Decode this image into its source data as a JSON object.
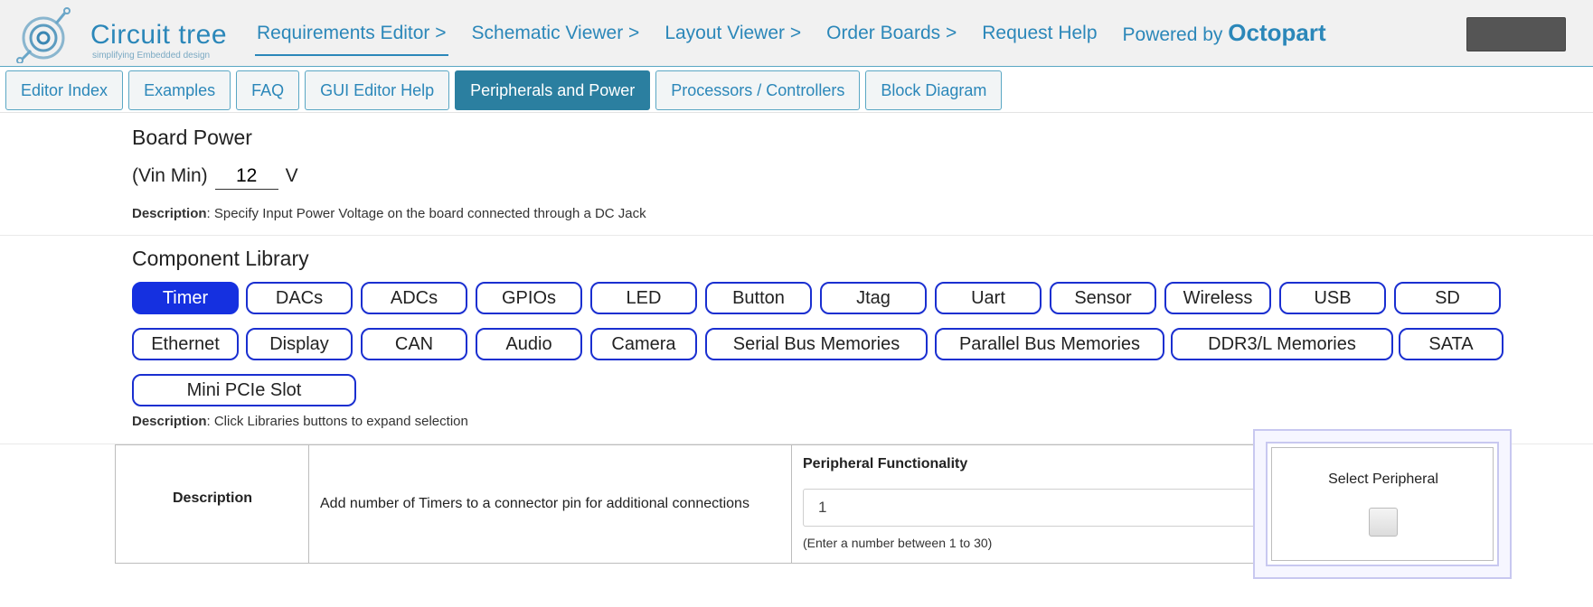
{
  "header": {
    "logo_text": "Circuit tree",
    "logo_sub": "simplifying Embedded design",
    "nav": [
      {
        "label": "Requirements Editor >"
      },
      {
        "label": "Schematic Viewer >"
      },
      {
        "label": "Layout Viewer >"
      },
      {
        "label": "Order Boards >"
      },
      {
        "label": "Request Help"
      }
    ],
    "powered_by": "Powered by",
    "octopart": "Octopart"
  },
  "tabs": [
    {
      "label": "Editor Index"
    },
    {
      "label": "Examples"
    },
    {
      "label": "FAQ"
    },
    {
      "label": "GUI Editor Help"
    },
    {
      "label": "Peripherals and Power"
    },
    {
      "label": "Processors / Controllers"
    },
    {
      "label": "Block Diagram"
    }
  ],
  "board_power": {
    "title": "Board Power",
    "vin_label": "(Vin Min)",
    "vin_value": "12",
    "unit": "V",
    "desc_label": "Description",
    "desc_text": ": Specify Input Power Voltage on the board connected through a DC Jack"
  },
  "library": {
    "title": "Component Library",
    "buttons": [
      "Timer",
      "DACs",
      "ADCs",
      "GPIOs",
      "LED",
      "Button",
      "Jtag",
      "Uart",
      "Sensor",
      "Wireless",
      "USB",
      "SD",
      "Ethernet",
      "Display",
      "CAN",
      "Audio",
      "Camera",
      "Serial Bus Memories",
      "Parallel Bus Memories",
      "DDR3/L Memories",
      "SATA",
      "Mini PCIe Slot"
    ],
    "desc_label": "Description",
    "desc_text": ": Click Libraries buttons to expand selection"
  },
  "table": {
    "col1": "Description",
    "col2": "Add number of Timers to a connector pin for additional connections",
    "pf_label": "Peripheral Functionality",
    "pf_value": "1",
    "pf_hint": "(Enter a number between 1 to 30)",
    "select_label": "Select Peripheral"
  },
  "colors": {
    "brand": "#2b87b9",
    "active_tab": "#2b7fa0",
    "library_border": "#1a2fd0",
    "library_active": "#1530e0"
  }
}
